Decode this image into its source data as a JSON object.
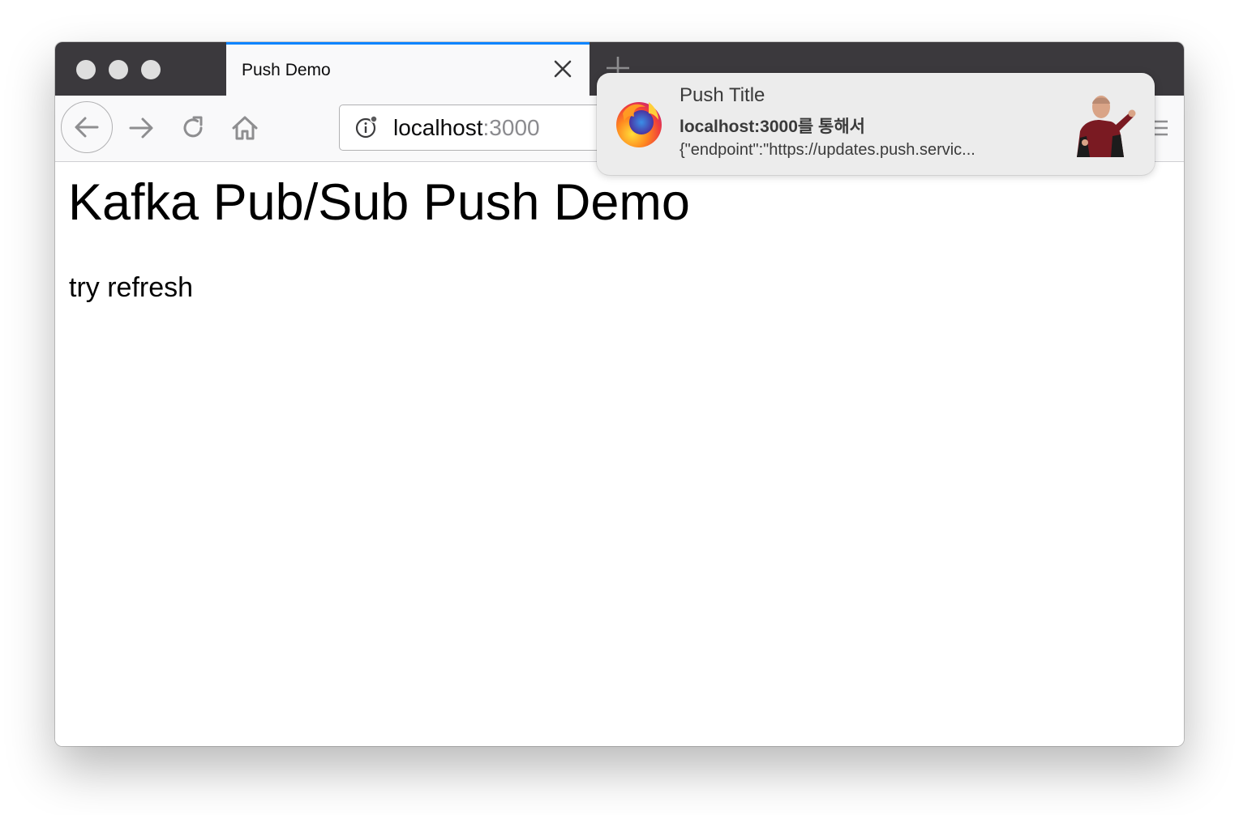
{
  "browser": {
    "tab": {
      "title": "Push Demo"
    },
    "url": {
      "host": "localhost",
      "port": ":3000"
    }
  },
  "page": {
    "heading": "Kafka Pub/Sub Push Demo",
    "paragraph": "try refresh"
  },
  "notification": {
    "title": "Push Title",
    "source": "localhost:3000를 통해서",
    "body": "{\"endpoint\":\"https://updates.push.servic...",
    "app_icon": "firefox-logo-icon",
    "image": "captain-pointing-image"
  },
  "icons": {
    "back": "back-arrow-icon",
    "forward": "forward-arrow-icon",
    "reload": "reload-icon",
    "home": "home-icon",
    "info": "site-info-icon",
    "close": "close-icon",
    "new_tab": "plus-icon",
    "menu": "hamburger-menu-icon"
  },
  "colors": {
    "tab_accent": "#0a84ff",
    "titlebar": "#3b393d",
    "toolbar": "#f9f9fa"
  }
}
